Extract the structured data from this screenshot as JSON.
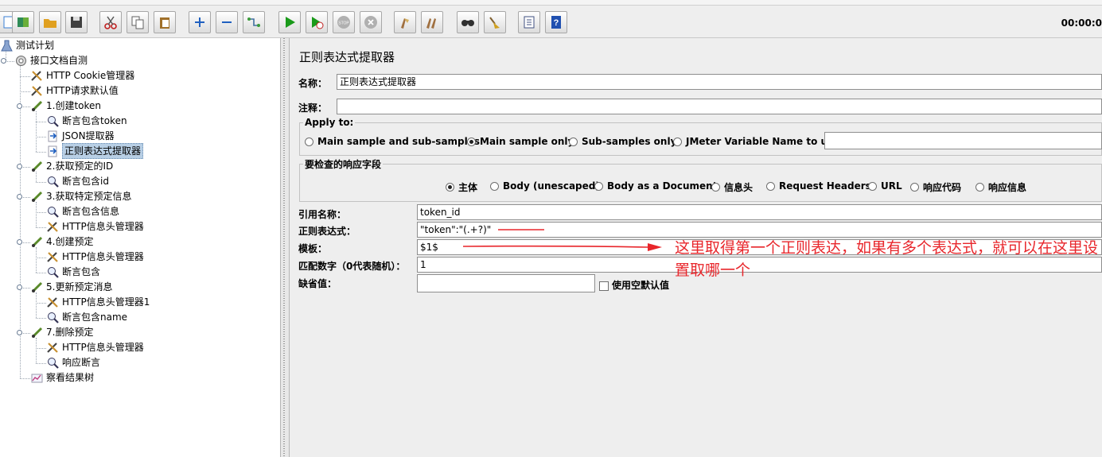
{
  "toolbar": {
    "buttons": [
      {
        "name": "new-icon",
        "color": "#3a7fd4"
      },
      {
        "name": "templates-icon",
        "color": "#2e8b57"
      },
      {
        "name": "open-icon",
        "color": "#e0a020"
      },
      {
        "name": "save-icon",
        "color": "#404040"
      },
      {
        "name": "cut-icon",
        "color": "#c02020"
      },
      {
        "name": "copy-icon",
        "color": "#606060"
      },
      {
        "name": "paste-icon",
        "color": "#a0702a"
      },
      {
        "name": "expand-icon",
        "color": "#2060c0"
      },
      {
        "name": "collapse-icon",
        "color": "#2060c0"
      },
      {
        "name": "toggle-icon",
        "color": "#4070a0"
      },
      {
        "name": "start-icon",
        "color": "#1a9a1a"
      },
      {
        "name": "start-no-pauses-icon",
        "color": "#1a9a1a"
      },
      {
        "name": "stop-icon",
        "color": "#b0b0b0"
      },
      {
        "name": "shutdown-icon",
        "color": "#b0b0b0"
      },
      {
        "name": "clear-icon",
        "color": "#a07040"
      },
      {
        "name": "clear-all-icon",
        "color": "#a07040"
      },
      {
        "name": "search-icon",
        "color": "#303030"
      },
      {
        "name": "reset-search-icon",
        "color": "#d0a020"
      },
      {
        "name": "function-helper-icon",
        "color": "#405080"
      },
      {
        "name": "help-icon",
        "color": "#2050b0"
      }
    ],
    "timer": "00:00:0"
  },
  "tree": {
    "nodes": [
      {
        "label": "测试计划",
        "icon": "test-plan-icon"
      },
      {
        "label": "接口文档自测",
        "icon": "thread-group-icon"
      },
      {
        "label": "HTTP Cookie管理器",
        "icon": "config-tool-icon"
      },
      {
        "label": "HTTP请求默认值",
        "icon": "config-tool-icon"
      },
      {
        "label": "1.创建token",
        "icon": "sampler-icon"
      },
      {
        "label": "断言包含token",
        "icon": "assertion-icon"
      },
      {
        "label": "JSON提取器",
        "icon": "extractor-icon"
      },
      {
        "label": "正则表达式提取器",
        "icon": "extractor-icon"
      },
      {
        "label": "2.获取预定的ID",
        "icon": "sampler-icon"
      },
      {
        "label": "断言包含id",
        "icon": "assertion-icon"
      },
      {
        "label": "3.获取特定预定信息",
        "icon": "sampler-icon"
      },
      {
        "label": "断言包含信息",
        "icon": "assertion-icon"
      },
      {
        "label": "HTTP信息头管理器",
        "icon": "config-tool-icon"
      },
      {
        "label": "4.创建预定",
        "icon": "sampler-icon"
      },
      {
        "label": "HTTP信息头管理器",
        "icon": "config-tool-icon"
      },
      {
        "label": "断言包含",
        "icon": "assertion-icon"
      },
      {
        "label": "5.更新预定消息",
        "icon": "sampler-icon"
      },
      {
        "label": "HTTP信息头管理器1",
        "icon": "config-tool-icon"
      },
      {
        "label": "断言包含name",
        "icon": "assertion-icon"
      },
      {
        "label": "7.删除预定",
        "icon": "sampler-icon"
      },
      {
        "label": "HTTP信息头管理器",
        "icon": "config-tool-icon"
      },
      {
        "label": "响应断言",
        "icon": "assertion-icon"
      },
      {
        "label": "察看结果树",
        "icon": "listener-icon"
      }
    ]
  },
  "panel": {
    "title": "正则表达式提取器",
    "name_label": "名称：",
    "name_value": "正则表达式提取器",
    "comment_label": "注释：",
    "comment_value": "",
    "apply_to": {
      "title": "Apply to:",
      "options": [
        "Main sample and sub-samples",
        "Main sample only",
        "Sub-samples only",
        "JMeter Variable Name to use"
      ],
      "selected": "Main sample only",
      "variable_value": ""
    },
    "response_field": {
      "title": "要检查的响应字段",
      "options": [
        "主体",
        "Body (unescaped)",
        "Body as a Document",
        "信息头",
        "Request Headers",
        "URL",
        "响应代码",
        "响应信息"
      ],
      "selected": "主体"
    },
    "ref_name_label": "引用名称：",
    "ref_name_value": "token_id",
    "regex_label": "正则表达式：",
    "regex_value": "\"token\":\"(.+?)\"",
    "template_label": "模板：",
    "template_value": "$1$",
    "match_no_label": "匹配数字（0代表随机）：",
    "match_no_value": "1",
    "default_label": "缺省值：",
    "default_value": "",
    "use_empty_label": "使用空默认值",
    "use_empty_checked": false
  },
  "annotation": {
    "text": "这里取得第一个正则表达，如果有多个表达式，就可以在这里设置取哪一个",
    "color": "#e8262b"
  }
}
